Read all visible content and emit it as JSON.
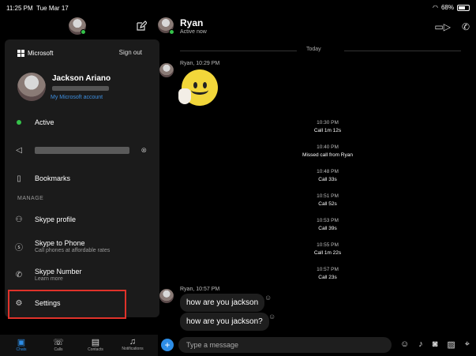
{
  "status_bar": {
    "time": "11:25 PM",
    "date": "Tue Mar 17",
    "battery": "68%"
  },
  "menu": {
    "brand": "Microsoft",
    "sign_out": "Sign out",
    "profile": {
      "name": "Jackson Ariano",
      "link": "My Microsoft account"
    },
    "items": {
      "active": "Active",
      "bookmarks": "Bookmarks",
      "section_manage": "MANAGE",
      "skype_profile": "Skype profile",
      "skype_to_phone": "Skype to Phone",
      "skype_to_phone_sub": "Call phones at affordable rates",
      "skype_number": "Skype Number",
      "skype_number_sub": "Learn more",
      "settings": "Settings"
    }
  },
  "bottom_tabs": [
    "Chats",
    "Calls",
    "Contacts",
    "Notifications"
  ],
  "chat": {
    "name": "Ryan",
    "status": "Active now",
    "divider": "Today",
    "first_meta": "Ryan, 10:29 PM",
    "calls": [
      {
        "time": "10:30 PM",
        "text": "Call 1m 12s"
      },
      {
        "time": "10:40 PM",
        "text": "Missed call from Ryan"
      },
      {
        "time": "10:48 PM",
        "text": "Call 33s"
      },
      {
        "time": "10:51 PM",
        "text": "Call 52s"
      },
      {
        "time": "10:53 PM",
        "text": "Call 39s"
      },
      {
        "time": "10:55 PM",
        "text": "Call 1m 22s"
      },
      {
        "time": "10:57 PM",
        "text": "Call 23s"
      }
    ],
    "second_meta": "Ryan, 10:57 PM",
    "messages": [
      "how are you jackson",
      "how are you jackson?"
    ],
    "input_placeholder": "Type a message"
  },
  "colors": {
    "accent": "#2d8de6",
    "presence": "#35c24a",
    "highlight": "#e0322a"
  }
}
